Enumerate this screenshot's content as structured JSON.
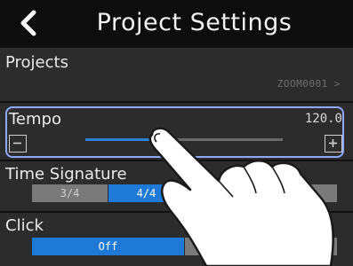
{
  "header": {
    "title": "Project Settings",
    "back_icon": "chevron-left-icon"
  },
  "projects": {
    "label": "Projects",
    "value": "ZOOM0001 >"
  },
  "tempo": {
    "label": "Tempo",
    "value": "120.0",
    "slider_fraction": 0.38,
    "minus_icon": "minus-icon",
    "plus_icon": "plus-icon"
  },
  "time_signature": {
    "label": "Time Signature",
    "options": [
      "3/4",
      "4/4",
      "",
      "8"
    ],
    "selected_index": 1
  },
  "click": {
    "label": "Click",
    "options": [
      "Off",
      ""
    ],
    "selected_index": 0
  },
  "colors": {
    "accent": "#1e7ad6",
    "highlight": "#8ea9ff"
  }
}
